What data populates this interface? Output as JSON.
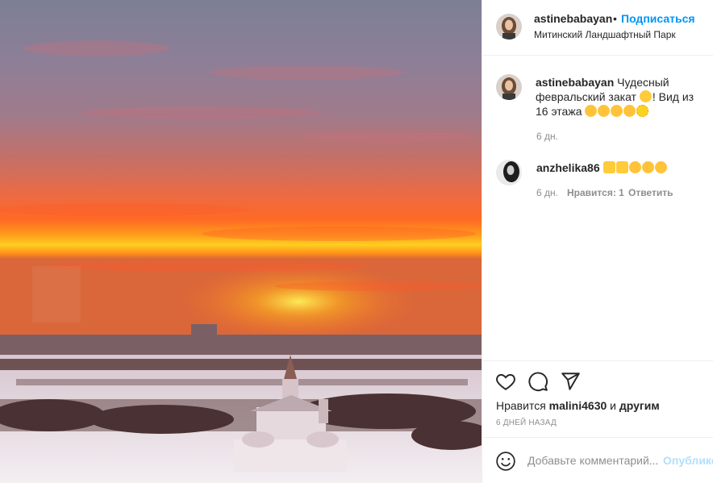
{
  "post": {
    "author": "astinebabayan",
    "dot": "•",
    "follow_label": "Подписаться",
    "location": "Митинский Ландшафтный Парк"
  },
  "caption": {
    "author": "astinebabayan",
    "text_before": "Чудесный февральский закат",
    "text_after": "! Вид из 16 этажа",
    "time": "6 дн."
  },
  "comment": {
    "author": "anzhelika86",
    "time": "6 дн.",
    "likes": "Нравится: 1",
    "reply": "Ответить"
  },
  "likes_line": {
    "prefix": "Нравится",
    "user": "malini4630",
    "middle": "и",
    "suffix": "другим"
  },
  "post_date": "6 ДНЕЙ НАЗАД",
  "add_comment": {
    "placeholder": "Добавьте комментарий...",
    "publish": "Опубликовать"
  },
  "icons": {
    "like": "heart-icon",
    "comment": "comment-icon",
    "share": "share-icon",
    "emoji": "smiley-icon"
  },
  "colors": {
    "link": "#0095f6",
    "muted": "#8e8e8e",
    "text": "#262626"
  }
}
